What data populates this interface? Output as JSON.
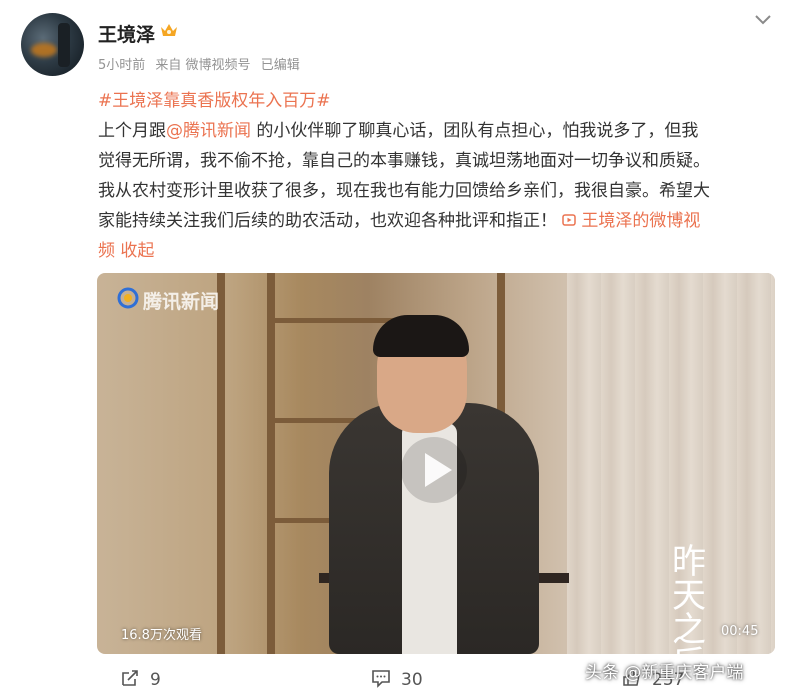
{
  "post": {
    "author": "王境泽",
    "meta": {
      "time": "5小时前",
      "source": "来自 微博视频号",
      "edited": "已编辑"
    },
    "hashtag": "#王境泽靠真香版权年入百万#",
    "lines": {
      "l1_a": "上个月跟",
      "l1_mention": "@腾讯新闻",
      "l1_b": " 的小伙伴聊了聊真心话，团队有点担心，怕我说多了，但我",
      "l2": "觉得无所谓，我不偷不抢，靠自己的本事赚钱，真诚坦荡地面对一切争议和质疑。",
      "l3": "我从农村变形计里收获了很多，现在我也有能力回馈给乡亲们，我很自豪。希望大",
      "l4_a": "家能持续关注我们后续的助农活动，也欢迎各种批评和指正！ ",
      "l4_link": "王境泽的微博视",
      "l5_link": "频",
      "collapse": "收起"
    }
  },
  "video": {
    "logo": "腾讯新闻",
    "views": "16.8万次观看",
    "duration": "00:45",
    "program_mark": "昨天之后"
  },
  "actions": {
    "share_count": "9",
    "comment_count": "30",
    "like_count": "257"
  },
  "watermark": "头条 @新重庆客户端",
  "colors": {
    "accent": "#eb7350",
    "text": "#333333",
    "meta": "#939393"
  }
}
